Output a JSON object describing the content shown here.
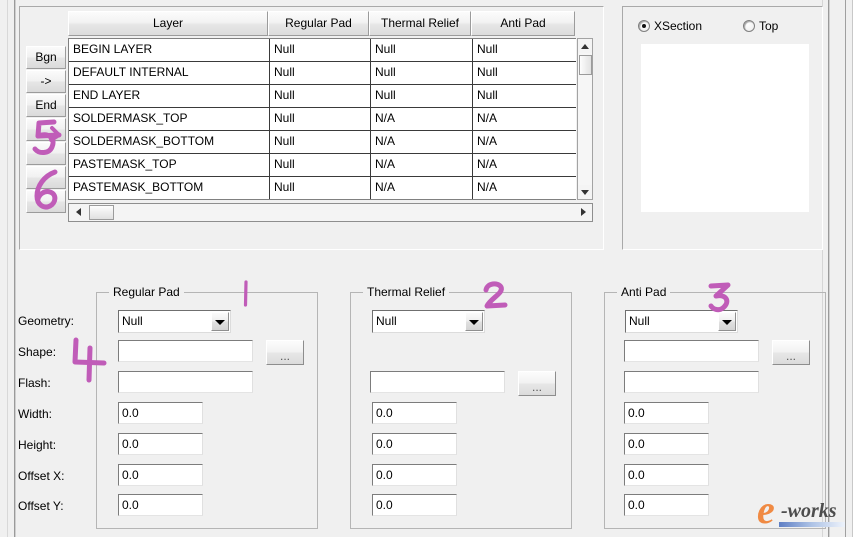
{
  "layer_table": {
    "columns": [
      "Layer",
      "Regular Pad",
      "Thermal Relief",
      "Anti Pad"
    ],
    "row_buttons": [
      "Bgn",
      "->",
      "End",
      "",
      "",
      "",
      ""
    ],
    "rows": [
      {
        "layer": "BEGIN LAYER",
        "regular_pad": "Null",
        "thermal_relief": "Null",
        "anti_pad": "Null"
      },
      {
        "layer": "DEFAULT INTERNAL",
        "regular_pad": "Null",
        "thermal_relief": "Null",
        "anti_pad": "Null"
      },
      {
        "layer": "END LAYER",
        "regular_pad": "Null",
        "thermal_relief": "Null",
        "anti_pad": "Null"
      },
      {
        "layer": "SOLDERMASK_TOP",
        "regular_pad": "Null",
        "thermal_relief": "N/A",
        "anti_pad": "N/A"
      },
      {
        "layer": "SOLDERMASK_BOTTOM",
        "regular_pad": "Null",
        "thermal_relief": "N/A",
        "anti_pad": "N/A"
      },
      {
        "layer": "PASTEMASK_TOP",
        "regular_pad": "Null",
        "thermal_relief": "N/A",
        "anti_pad": "N/A"
      },
      {
        "layer": "PASTEMASK_BOTTOM",
        "regular_pad": "Null",
        "thermal_relief": "N/A",
        "anti_pad": "N/A"
      }
    ]
  },
  "preview": {
    "view_options": [
      {
        "label": "XSection",
        "selected": true
      },
      {
        "label": "Top",
        "selected": false
      }
    ]
  },
  "field_labels": [
    "Geometry:",
    "Shape:",
    "Flash:",
    "Width:",
    "Height:",
    "Offset X:",
    "Offset Y:"
  ],
  "groups": {
    "regular_pad": {
      "title": "Regular Pad",
      "geometry": "Null",
      "shape": "",
      "flash": "",
      "width": "0.0",
      "height": "0.0",
      "offset_x": "0.0",
      "offset_y": "0.0",
      "browse_label": "..."
    },
    "thermal_relief": {
      "title": "Thermal Relief",
      "geometry": "Null",
      "flash": "",
      "width": "0.0",
      "height": "0.0",
      "offset_x": "0.0",
      "offset_y": "0.0",
      "browse_label": "..."
    },
    "anti_pad": {
      "title": "Anti Pad",
      "geometry": "Null",
      "shape": "",
      "flash": "",
      "width": "0.0",
      "height": "0.0",
      "offset_x": "0.0",
      "offset_y": "0.0",
      "browse_label": "..."
    }
  },
  "annotations": [
    {
      "id": "1",
      "text": "1"
    },
    {
      "id": "2",
      "text": "2"
    },
    {
      "id": "3",
      "text": "3"
    },
    {
      "id": "4",
      "text": "4"
    },
    {
      "id": "5",
      "text": "5"
    },
    {
      "id": "6",
      "text": "6"
    }
  ],
  "watermark": {
    "mark": "e",
    "word": "-works"
  },
  "colors": {
    "annotation": "#c05cb8",
    "window_background": "#f0f0f0",
    "field_background": "#ffffff",
    "watermark_orange": "#f08a43"
  }
}
